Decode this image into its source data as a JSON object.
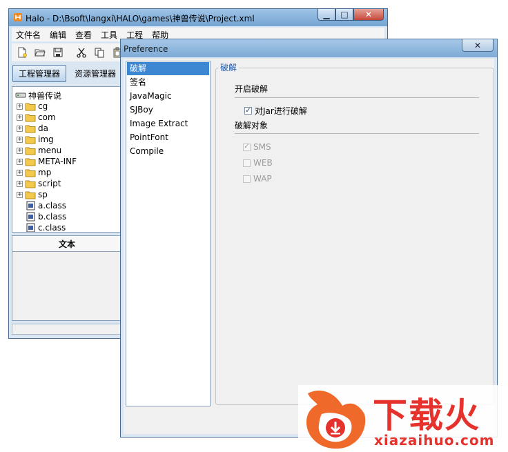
{
  "main_window": {
    "title": "Halo - D:\\Bsoft\\langxi\\HALO\\games\\神兽传说\\Project.xml",
    "caption_buttons": {
      "minimize": "▁",
      "maximize": "□",
      "close": "✕"
    },
    "menu": [
      "文件名",
      "编辑",
      "查看",
      "工具",
      "工程",
      "帮助"
    ],
    "toolbar_icons": [
      "new-file-icon",
      "open-folder-icon",
      "save-icon",
      "cut-icon",
      "copy-icon",
      "paste-icon"
    ],
    "tabs": {
      "active": "工程管理器",
      "inactive": "资源管理器"
    },
    "tree": {
      "root": "神兽传说",
      "folders": [
        "cg",
        "com",
        "da",
        "img",
        "menu",
        "META-INF",
        "mp",
        "script",
        "sp"
      ],
      "files": [
        "a.class",
        "b.class",
        "c.class"
      ]
    },
    "text_panel_header": "文本"
  },
  "preference_dialog": {
    "title": "Preference",
    "close_glyph": "✕",
    "categories": [
      "破解",
      "签名",
      "JavaMagic",
      "SJBoy",
      "Image Extract",
      "PointFont",
      "Compile"
    ],
    "selected_category": "破解",
    "group_title": "破解",
    "section_enable": "开启破解",
    "enable_checkbox": {
      "label": "对Jar进行破解",
      "checked": true,
      "enabled": true
    },
    "section_targets": "破解对象",
    "targets": [
      {
        "label": "SMS",
        "checked": true,
        "enabled": false
      },
      {
        "label": "WEB",
        "checked": false,
        "enabled": false
      },
      {
        "label": "WAP",
        "checked": false,
        "enabled": false
      }
    ]
  },
  "watermark": {
    "brand_cn": "下载火",
    "brand_domain": "xiazaihuo.com"
  },
  "colors": {
    "selection_blue": "#3d86d2",
    "group_title_blue": "#1c56a8",
    "watermark_red": "#e5322d",
    "folder_yellow": "#f2c94c"
  }
}
